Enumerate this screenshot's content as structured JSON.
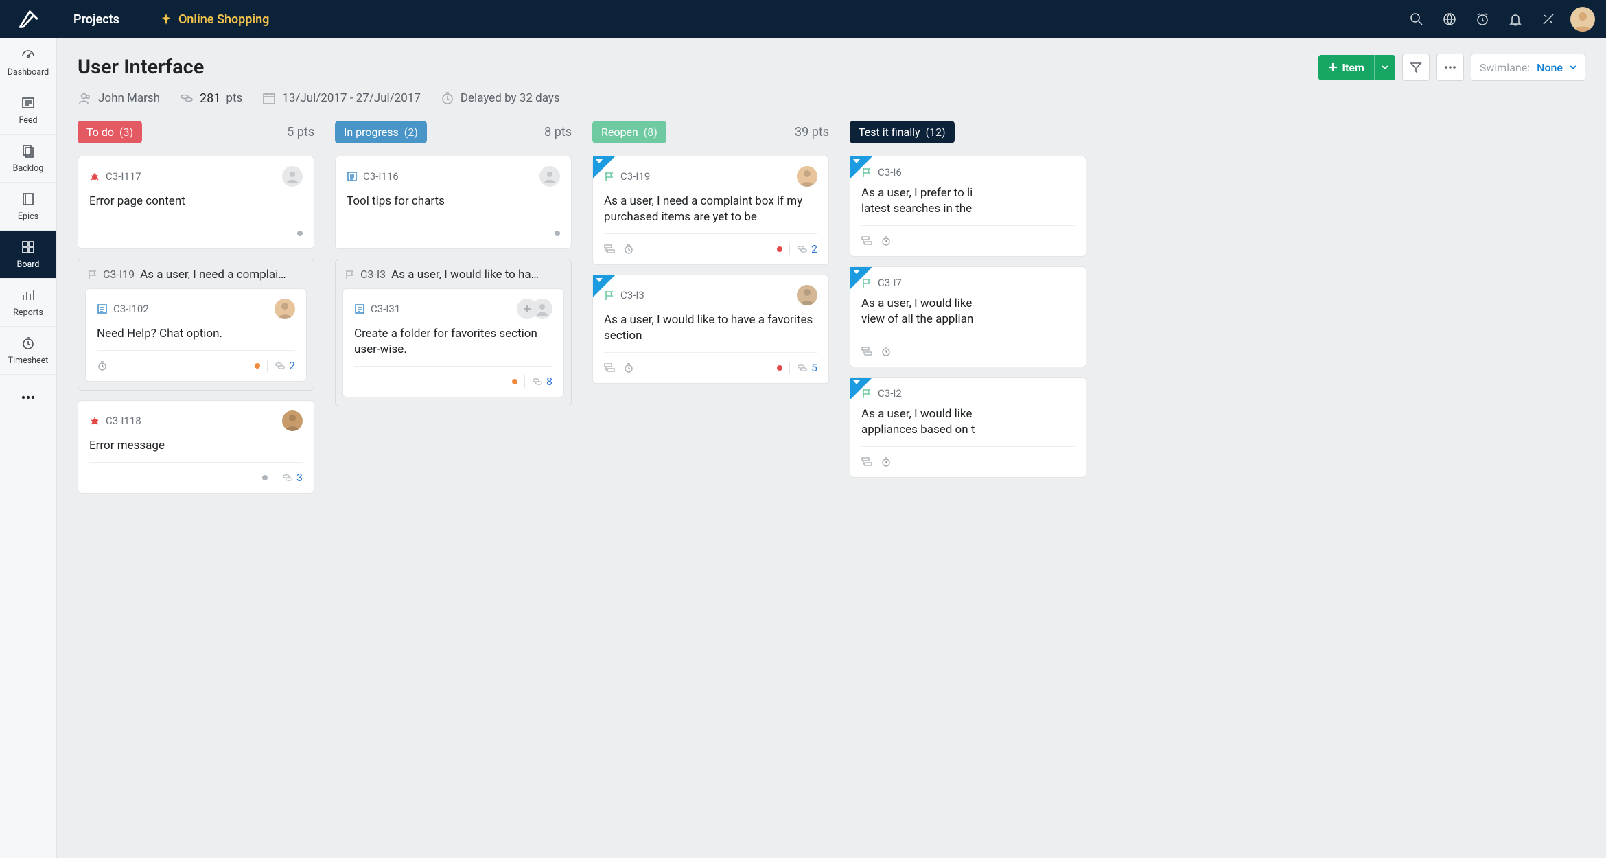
{
  "top": {
    "projects_label": "Projects",
    "project_name": "Online Shopping"
  },
  "sidebar": {
    "items": [
      {
        "label": "Dashboard"
      },
      {
        "label": "Feed"
      },
      {
        "label": "Backlog"
      },
      {
        "label": "Epics"
      },
      {
        "label": "Board"
      },
      {
        "label": "Reports"
      },
      {
        "label": "Timesheet"
      }
    ]
  },
  "page": {
    "title": "User Interface",
    "owner": "John Marsh",
    "points": "281",
    "points_unit": "pts",
    "date_range": "13/Jul/2017  -  27/Jul/2017",
    "delay": "Delayed by 32 days",
    "add_item_label": "Item",
    "swimlane_label": "Swimlane:",
    "swimlane_value": "None"
  },
  "board": {
    "columns": [
      {
        "name": "To do",
        "count": "(3)",
        "pts": "5 pts",
        "pill_class": "pill-red",
        "swimlane": {
          "id": "C3-I19",
          "title": "As a user, I need a complai…"
        },
        "cards": [
          {
            "id": "C3-I117",
            "title": "Error page content",
            "type": "bug",
            "avatar": "gray",
            "footer_dot": "gray",
            "pts": ""
          },
          {
            "id": "C3-I102",
            "title": "Need Help? Chat option.",
            "type": "task",
            "avatar": "user1",
            "footer_dot": "orange",
            "pts": "2",
            "timer": true
          },
          {
            "id": "C3-I118",
            "title": "Error message",
            "type": "bug",
            "avatar": "user2",
            "footer_dot": "gray",
            "pts": "3"
          }
        ]
      },
      {
        "name": "In progress",
        "count": "(2)",
        "pts": "8 pts",
        "pill_class": "pill-blue",
        "swimlane": {
          "id": "C3-I3",
          "title": "As a user, I would like to ha…"
        },
        "cards": [
          {
            "id": "C3-I116",
            "title": "Tool tips for charts",
            "type": "task",
            "avatar": "gray",
            "footer_dot": "gray",
            "pts": ""
          },
          {
            "id": "C3-I31",
            "title": "Create a folder for favorites section user-wise.",
            "type": "task",
            "avatar": "pair",
            "footer_dot": "orange",
            "pts": "8"
          }
        ]
      },
      {
        "name": "Reopen",
        "count": "(8)",
        "pts": "39 pts",
        "pill_class": "pill-green",
        "cards": [
          {
            "id": "C3-I19",
            "title": "As a user, I need a complaint box if my purchased items are yet to be",
            "type": "flag",
            "avatar": "user1",
            "footer_dot": "red",
            "pts": "2",
            "corner": true,
            "footer_icons": true
          },
          {
            "id": "C3-I3",
            "title": "As a user, I would like to have a favorites section",
            "type": "flag",
            "avatar": "user3",
            "footer_dot": "red",
            "pts": "5",
            "corner": true,
            "footer_icons": true
          }
        ]
      },
      {
        "name": "Test it finally",
        "count": "(12)",
        "pts": "",
        "pill_class": "pill-navy",
        "cards": [
          {
            "id": "C3-I6",
            "title": "As a user, I prefer to li\nlatest searches in the",
            "type": "flag",
            "corner": true,
            "footer_icons": true
          },
          {
            "id": "C3-I7",
            "title": "As a user, I would like\nview of all the applian",
            "type": "flag",
            "corner": true,
            "footer_icons": true
          },
          {
            "id": "C3-I2",
            "title": "As a user, I would like\nappliances based on t",
            "type": "flag",
            "corner": true,
            "footer_icons": true
          }
        ]
      }
    ]
  }
}
